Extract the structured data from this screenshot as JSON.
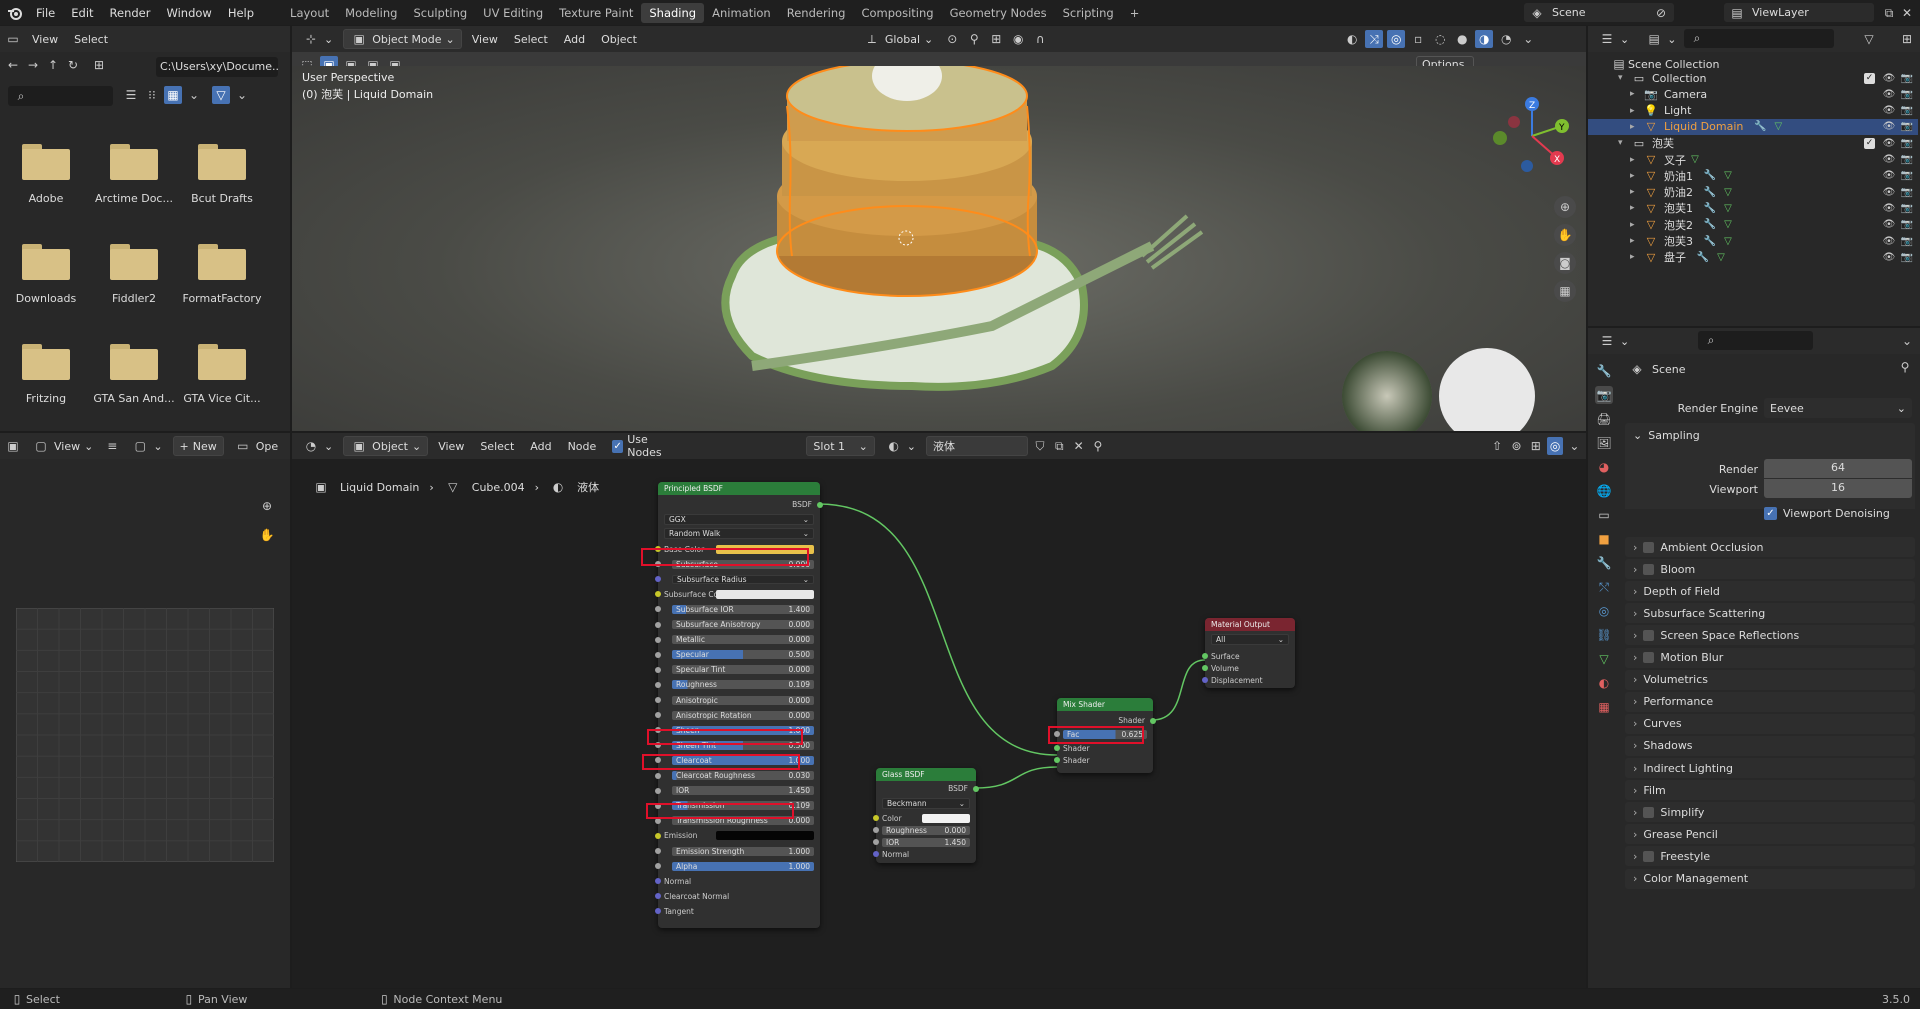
{
  "topbar": {
    "menus": [
      "File",
      "Edit",
      "Render",
      "Window",
      "Help"
    ],
    "workspaces": [
      "Layout",
      "Modeling",
      "Sculpting",
      "UV Editing",
      "Texture Paint",
      "Shading",
      "Animation",
      "Rendering",
      "Compositing",
      "Geometry Nodes",
      "Scripting"
    ],
    "active_workspace": "Shading",
    "add_tab": "+",
    "scene": "Scene",
    "viewlayer": "ViewLayer"
  },
  "file_browser": {
    "menus": [
      "View",
      "Select"
    ],
    "path": "C:\\Users\\xy\\Docume...",
    "folders": [
      "Adobe",
      "Arctime Doc...",
      "Bcut Drafts",
      "Downloads",
      "Fiddler2",
      "FormatFactory",
      "Fritzing",
      "GTA San And...",
      "GTA Vice Cit..."
    ]
  },
  "image_editor": {
    "view": "View",
    "new": "New",
    "open": "Ope"
  },
  "viewport": {
    "mode": "Object Mode",
    "menus": [
      "View",
      "Select",
      "Add",
      "Object"
    ],
    "orientation": "Global",
    "options": "Options",
    "overlay_line1": "User Perspective",
    "overlay_line2": "(0) 泡芙 | Liquid Domain",
    "gizmo": {
      "x": "X",
      "y": "Y",
      "z": "Z"
    }
  },
  "node_editor": {
    "type": "Object",
    "menus": [
      "View",
      "Select",
      "Add",
      "Node"
    ],
    "use_nodes": "Use Nodes",
    "slot": "Slot 1",
    "material": "液体",
    "breadcrumb": [
      "Liquid Domain",
      "Cube.004",
      "液体"
    ],
    "principled": {
      "title": "Principled BSDF",
      "output": "BSDF",
      "distribution": "GGX",
      "subsurface_method": "Random Walk",
      "rows": [
        {
          "label": "Base Color",
          "value": "",
          "type": "color",
          "color": "#e8c14a",
          "sock": "#c7c729"
        },
        {
          "label": "Subsurface",
          "value": "0.000",
          "type": "num",
          "fill": 0,
          "sock": "#a1a1a1"
        },
        {
          "label": "Subsurface Radius",
          "value": "",
          "type": "dropdown",
          "sock": "#6363c7"
        },
        {
          "label": "Subsurface Color",
          "value": "",
          "type": "color",
          "color": "#e6e6e6",
          "sock": "#c7c729"
        },
        {
          "label": "Subsurface IOR",
          "value": "1.400",
          "type": "num",
          "fill": 0.1,
          "sock": "#a1a1a1"
        },
        {
          "label": "Subsurface Anisotropy",
          "value": "0.000",
          "type": "num",
          "fill": 0,
          "sock": "#a1a1a1"
        },
        {
          "label": "Metallic",
          "value": "0.000",
          "type": "num",
          "fill": 0,
          "sock": "#a1a1a1"
        },
        {
          "label": "Specular",
          "value": "0.500",
          "type": "num",
          "fill": 0.5,
          "sock": "#a1a1a1"
        },
        {
          "label": "Specular Tint",
          "value": "0.000",
          "type": "num",
          "fill": 0,
          "sock": "#a1a1a1"
        },
        {
          "label": "Roughness",
          "value": "0.109",
          "type": "num",
          "fill": 0.109,
          "sock": "#a1a1a1"
        },
        {
          "label": "Anisotropic",
          "value": "0.000",
          "type": "num",
          "fill": 0,
          "sock": "#a1a1a1"
        },
        {
          "label": "Anisotropic Rotation",
          "value": "0.000",
          "type": "num",
          "fill": 0,
          "sock": "#a1a1a1"
        },
        {
          "label": "Sheen",
          "value": "1.000",
          "type": "num",
          "fill": 1,
          "sock": "#a1a1a1"
        },
        {
          "label": "Sheen Tint",
          "value": "0.500",
          "type": "num",
          "fill": 0.5,
          "sock": "#a1a1a1"
        },
        {
          "label": "Clearcoat",
          "value": "1.000",
          "type": "num",
          "fill": 1,
          "sock": "#a1a1a1"
        },
        {
          "label": "Clearcoat Roughness",
          "value": "0.030",
          "type": "num",
          "fill": 0.03,
          "sock": "#a1a1a1"
        },
        {
          "label": "IOR",
          "value": "1.450",
          "type": "num",
          "fill": 0,
          "sock": "#a1a1a1"
        },
        {
          "label": "Transmission",
          "value": "0.109",
          "type": "num",
          "fill": 0.109,
          "sock": "#a1a1a1"
        },
        {
          "label": "Transmission Roughness",
          "value": "0.000",
          "type": "num",
          "fill": 0,
          "sock": "#a1a1a1"
        },
        {
          "label": "Emission",
          "value": "",
          "type": "color",
          "color": "#050505",
          "sock": "#c7c729"
        },
        {
          "label": "Emission Strength",
          "value": "1.000",
          "type": "num",
          "fill": 0,
          "sock": "#a1a1a1"
        },
        {
          "label": "Alpha",
          "value": "1.000",
          "type": "num",
          "fill": 1,
          "sock": "#a1a1a1"
        },
        {
          "label": "Normal",
          "value": "",
          "type": "text",
          "sock": "#6363c7"
        },
        {
          "label": "Clearcoat Normal",
          "value": "",
          "type": "text",
          "sock": "#6363c7"
        },
        {
          "label": "Tangent",
          "value": "",
          "type": "text",
          "sock": "#6363c7"
        }
      ]
    },
    "glass": {
      "title": "Glass BSDF",
      "output": "BSDF",
      "distribution": "Beckmann",
      "color_label": "Color",
      "roughness_label": "Roughness",
      "roughness": "0.000",
      "ior_label": "IOR",
      "ior": "1.450",
      "normal_label": "Normal"
    },
    "mix": {
      "title": "Mix Shader",
      "output": "Shader",
      "fac_label": "Fac",
      "fac": "0.625",
      "shader1": "Shader",
      "shader2": "Shader"
    },
    "output_node": {
      "title": "Material Output",
      "target": "All",
      "surface": "Surface",
      "volume": "Volume",
      "displacement": "Displacement"
    }
  },
  "outliner": {
    "scene_collection": "Scene Collection",
    "items": [
      {
        "name": "Collection",
        "level": 1,
        "kind": "collection"
      },
      {
        "name": "Camera",
        "level": 2,
        "kind": "camera"
      },
      {
        "name": "Light",
        "level": 2,
        "kind": "light"
      },
      {
        "name": "Liquid Domain",
        "level": 2,
        "kind": "mesh",
        "selected": true
      },
      {
        "name": "泡芙",
        "level": 1,
        "kind": "collection"
      },
      {
        "name": "叉子",
        "level": 2,
        "kind": "mesh"
      },
      {
        "name": "奶油1",
        "level": 2,
        "kind": "mesh"
      },
      {
        "name": "奶油2",
        "level": 2,
        "kind": "mesh"
      },
      {
        "name": "泡芙1",
        "level": 2,
        "kind": "mesh"
      },
      {
        "name": "泡芙2",
        "level": 2,
        "kind": "mesh"
      },
      {
        "name": "泡芙3",
        "level": 2,
        "kind": "mesh"
      },
      {
        "name": "盘子",
        "level": 2,
        "kind": "mesh"
      }
    ]
  },
  "properties": {
    "context": "Scene",
    "render_engine_label": "Render Engine",
    "render_engine": "Eevee",
    "sampling": "Sampling",
    "render_label": "Render",
    "render": "64",
    "viewport_label": "Viewport",
    "viewport": "16",
    "viewport_denoising": "Viewport Denoising",
    "panels": [
      {
        "label": "Ambient Occlusion",
        "check": true
      },
      {
        "label": "Bloom",
        "check": true
      },
      {
        "label": "Depth of Field",
        "check": false
      },
      {
        "label": "Subsurface Scattering",
        "check": false
      },
      {
        "label": "Screen Space Reflections",
        "check": true
      },
      {
        "label": "Motion Blur",
        "check": true
      },
      {
        "label": "Volumetrics",
        "check": false
      },
      {
        "label": "Performance",
        "check": false
      },
      {
        "label": "Curves",
        "check": false
      },
      {
        "label": "Shadows",
        "check": false
      },
      {
        "label": "Indirect Lighting",
        "check": false
      },
      {
        "label": "Film",
        "check": false
      },
      {
        "label": "Simplify",
        "check": true
      },
      {
        "label": "Grease Pencil",
        "check": false
      },
      {
        "label": "Freestyle",
        "check": true
      },
      {
        "label": "Color Management",
        "check": false
      }
    ]
  },
  "statusbar": {
    "select": "Select",
    "pan": "Pan View",
    "context_menu": "Node Context Menu",
    "version": "3.5.0"
  },
  "colors": {
    "accent": "#4772b3",
    "selection": "#ff8c1a",
    "highlight_red": "#e0102a",
    "shader_link": "#63c763"
  }
}
